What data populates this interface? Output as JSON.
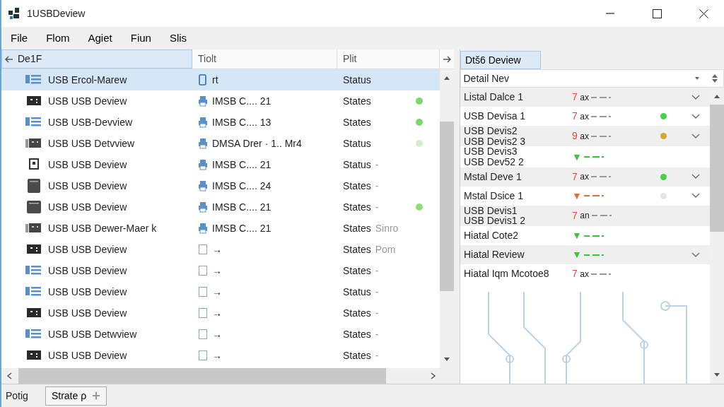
{
  "window": {
    "title": "1USBDeview"
  },
  "menu": [
    "File",
    "Flom",
    "Agiet",
    "Fiun",
    "Slis"
  ],
  "device_list": {
    "columns": [
      {
        "label": "De1F",
        "selected": true
      },
      {
        "label": "Tiolt",
        "selected": false
      },
      {
        "label": "Plit",
        "selected": false
      }
    ],
    "rows": [
      {
        "kind": "list",
        "name": "USB Ercol-Marew",
        "type": {
          "kind": "phone",
          "text": "rt"
        },
        "status": "Status",
        "selected": true
      },
      {
        "kind": "port",
        "name": "USB USB Deview",
        "type": {
          "kind": "printer",
          "text": "IMSB C.... 21"
        },
        "status": "States",
        "selected": false,
        "color": "#7ed66b"
      },
      {
        "kind": "list",
        "name": "USB USB-Devview",
        "type": {
          "kind": "printer",
          "text": "IMSB C.... 13"
        },
        "status": "States",
        "selected": false,
        "color": "#7ed66b"
      },
      {
        "kind": "drive",
        "name": "USB USB Detvview",
        "type": {
          "kind": "printer",
          "text": "DMSA Drer · 1..  Mr4"
        },
        "status": "Status",
        "selected": false,
        "color": "#d3eecb"
      },
      {
        "kind": "plug",
        "name": "USB USB Deview",
        "type": {
          "kind": "printer",
          "text": "IMSB C.... 21"
        },
        "status": "Status",
        "extra": "-",
        "selected": false
      },
      {
        "kind": "tall",
        "name": "USB USB Deview",
        "type": {
          "kind": "printer",
          "text": "IMSB C.... 24"
        },
        "status": "States",
        "extra": "-",
        "selected": false
      },
      {
        "kind": "box",
        "name": "USB USB Deview",
        "type": {
          "kind": "printer",
          "text": "IMSB C.... 21"
        },
        "status": "States",
        "extra": "-",
        "selected": false,
        "color": "#8fdc7f"
      },
      {
        "kind": "drive",
        "name": "USB USB Dewer-Maer k",
        "type": {
          "kind": "printer",
          "text": "IMSB C.... 21"
        },
        "status": "States",
        "extra": "Sinro",
        "selected": false
      },
      {
        "kind": "port",
        "name": "USB USB Deview",
        "type": {
          "kind": "square",
          "text": "→"
        },
        "status": "States",
        "extra": "Pom",
        "selected": false
      },
      {
        "kind": "list",
        "name": "USB USB Deview",
        "type": {
          "kind": "square",
          "text": "→"
        },
        "status": "States",
        "extra": "-",
        "selected": false
      },
      {
        "kind": "list",
        "name": "USB USB Deview",
        "type": {
          "kind": "square",
          "text": "→"
        },
        "status": "Status",
        "extra": "-",
        "selected": false
      },
      {
        "kind": "port",
        "name": "USB USB Deview",
        "type": {
          "kind": "square",
          "text": "→"
        },
        "status": "States",
        "extra": "-",
        "selected": false
      },
      {
        "kind": "list",
        "name": "USB USB Detwview",
        "type": {
          "kind": "square",
          "text": "→"
        },
        "status": "States",
        "extra": "-",
        "selected": false
      },
      {
        "kind": "port",
        "name": "USB USB Deview",
        "type": {
          "kind": "square",
          "text": "→"
        },
        "status": "States",
        "extra": "-",
        "selected": false
      }
    ]
  },
  "detail_panel": {
    "tab": {
      "label": "Dtš6 Deview",
      "selected": true
    },
    "dropdown": {
      "value": "Detail Nev"
    },
    "rows": [
      {
        "name_lines": [
          "Listal Dalce 1"
        ],
        "mark": "7",
        "unit": "ax",
        "color": "#d8502f",
        "chevron": true
      },
      {
        "name_lines": [
          "USB Devisa 1"
        ],
        "mark": "7",
        "unit": "ax",
        "color": "#d8502f",
        "status": {
          "color": "#49d049"
        },
        "chevron": true
      },
      {
        "name_lines": [
          "USB Devis2",
          "USB Devis2 3"
        ],
        "mark": "9",
        "unit": "ax",
        "color": "#d8502f",
        "status": {
          "color": "#d4a92a"
        },
        "chevron": true
      },
      {
        "name_lines": [
          "USB Devis3",
          "USB Dev52 2"
        ],
        "mark": "▼",
        "color": "#3cc43c",
        "chevron": false
      },
      {
        "name_lines": [
          "Mstal Deve 1"
        ],
        "mark": "7",
        "unit": "ax",
        "color": "#d8502f",
        "status": {
          "color": "#49d049"
        },
        "chevron": true
      },
      {
        "name_lines": [
          "Mstal Dsice 1"
        ],
        "mark": "▼",
        "color": "#e0703a",
        "status": {
          "color": "#e4e4e4"
        },
        "chevron": true
      },
      {
        "name_lines": [
          "USB Devis1",
          "USB Devis1 2"
        ],
        "mark": "7",
        "unit": "an",
        "color": "#d8502f",
        "chevron": false
      },
      {
        "name_lines": [
          "Hiatal Cote2"
        ],
        "mark": "▼",
        "color": "#3cc43c",
        "chevron": false
      },
      {
        "name_lines": [
          "Hiatal Review"
        ],
        "mark": "▼",
        "color": "#3cc43c",
        "chevron": true
      },
      {
        "name_lines": [
          "Hiatal Iqm Mcotoe8"
        ],
        "mark": "7",
        "unit": "ax",
        "color": "#d8502f",
        "chevron": false
      }
    ]
  },
  "status_bar": {
    "text": "Potig",
    "button": "Strate ρ"
  }
}
